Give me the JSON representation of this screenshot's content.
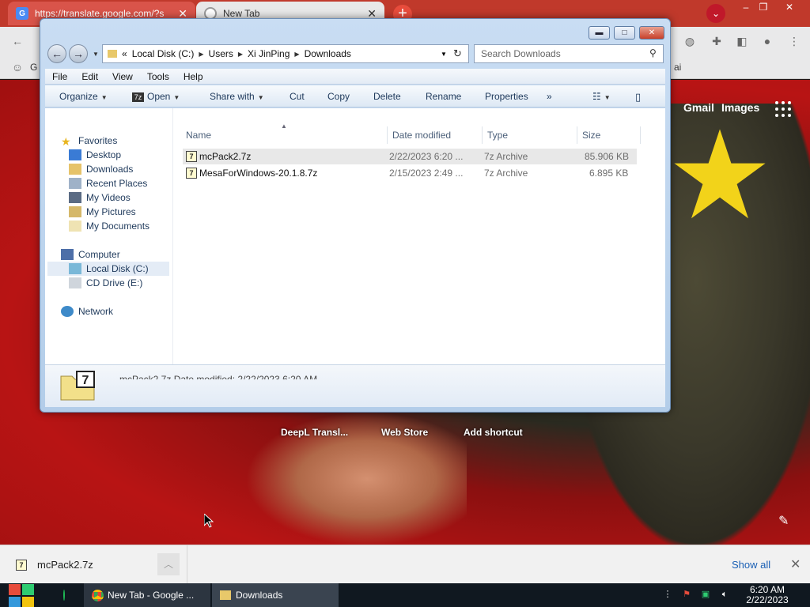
{
  "chrome": {
    "tabs": [
      {
        "title": "https://translate.google.com/?s",
        "favicon": "G"
      },
      {
        "title": "New Tab",
        "favicon": ""
      }
    ],
    "new_tab": "+",
    "window_controls": {
      "minimize": "–",
      "maximize": "❐",
      "close": "✕"
    },
    "bookmarks_fragment": "G",
    "bookmarks_right_fragment": "ai"
  },
  "newtab_page": {
    "gmail": "Gmail",
    "images": "Images",
    "shortcuts": [
      "DeepL Transl...",
      "Web Store",
      "Add shortcut"
    ]
  },
  "explorer": {
    "breadcrumbs": [
      "Local Disk (C:)",
      "Users",
      "Xi JinPing",
      "Downloads"
    ],
    "crumb_prefix": "«",
    "search_placeholder": "Search Downloads",
    "menu": [
      "File",
      "Edit",
      "View",
      "Tools",
      "Help"
    ],
    "commands": {
      "organize": "Organize",
      "open": "Open",
      "share_with": "Share with",
      "cut": "Cut",
      "copy": "Copy",
      "delete": "Delete",
      "rename": "Rename",
      "properties": "Properties",
      "more": "»"
    },
    "nav": {
      "favorites": "Favorites",
      "favorites_items": [
        "Desktop",
        "Downloads",
        "Recent Places",
        "My Videos",
        "My Pictures",
        "My Documents"
      ],
      "computer": "Computer",
      "computer_items": [
        "Local Disk (C:)",
        "CD Drive (E:)"
      ],
      "network": "Network"
    },
    "columns": {
      "name": "Name",
      "date": "Date modified",
      "type": "Type",
      "size": "Size"
    },
    "files": [
      {
        "name": "mcPack2.7z",
        "date": "2/22/2023 6:20 ...",
        "type": "7z Archive",
        "size": "85.906 KB"
      },
      {
        "name": "MesaForWindows-20.1.8.7z",
        "date": "2/15/2023 2:49 ...",
        "type": "7z Archive",
        "size": "6.895 KB"
      }
    ],
    "details": "mcPack2.7z     Date modified: 2/22/2023 6:20 AM"
  },
  "download_bar": {
    "file": "mcPack2.7z",
    "show_all": "Show all"
  },
  "taskbar": {
    "chrome_item": "New Tab - Google ...",
    "downloads_item": "Downloads",
    "time": "6:20 AM",
    "date": "2/22/2023"
  }
}
